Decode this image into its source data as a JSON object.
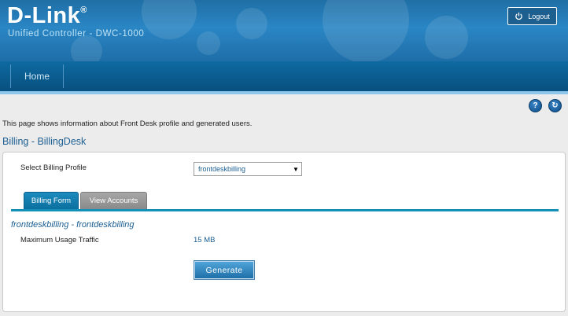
{
  "header": {
    "logo": "D-Link",
    "logo_mark": "®",
    "subtitle": "Unified Controller - DWC-1000",
    "logout_label": "Logout"
  },
  "nav": {
    "items": [
      {
        "label": "Home"
      }
    ]
  },
  "help_icons": [
    {
      "name": "help-icon",
      "glyph": "?"
    },
    {
      "name": "refresh-icon",
      "glyph": "↻"
    }
  ],
  "page": {
    "description": "This page shows information about Front Desk profile and generated users.",
    "title": "Billing - BillingDesk"
  },
  "form": {
    "profile_label": "Select Billing Profile",
    "profile_selected": "frontdeskbilling",
    "tabs": [
      {
        "label": "Billing Form",
        "active": true
      },
      {
        "label": "View Accounts",
        "active": false
      }
    ],
    "section_title": "frontdeskbilling - frontdeskbilling",
    "usage_label": "Maximum Usage Traffic",
    "usage_value": "15 MB",
    "generate_label": "Generate"
  },
  "colors": {
    "brand_blue": "#1f6fa6",
    "nav_blue": "#08507f",
    "accent_teal": "#1490b8",
    "title_blue": "#1c5f93"
  }
}
